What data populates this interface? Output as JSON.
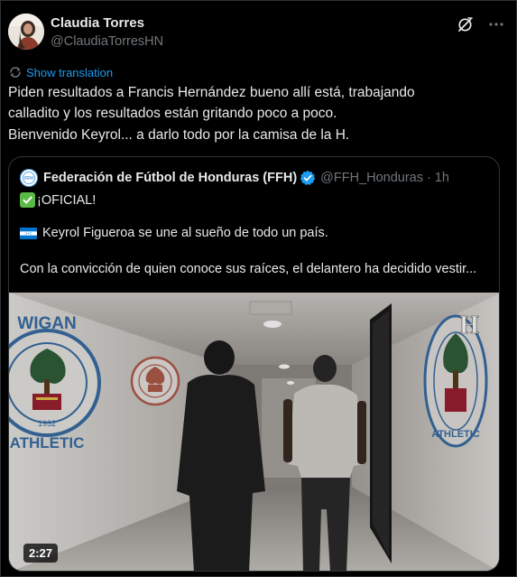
{
  "author": {
    "name": "Claudia Torres",
    "handle": "@ClaudiaTorresHN"
  },
  "actions": {
    "grok_icon": "grok-icon",
    "more_icon": "more-icon"
  },
  "translate": {
    "label": "Show translation",
    "icon": "translate-icon"
  },
  "tweet": {
    "lines": [
      "Piden resultados a Francis Hernández bueno allí está, trabajando",
      "calladito y los resultados están gritando poco a poco.",
      "Bienvenido Keyrol... a darlo todo por la camisa de la H."
    ]
  },
  "quote": {
    "name": "Federación de Fútbol de Honduras (FFH)",
    "handle": "@FFH_Honduras",
    "separator": "·",
    "time": "1h",
    "line1": "¡OFICIAL!",
    "line2": "Keyrol Figueroa se une al sueño de todo un país.",
    "line3": "Con la convicción de quien conoce sus raíces, el delantero ha decidido vestir...",
    "logo_text": "FFH",
    "media": {
      "duration": "2:27",
      "badge_left_top": "WIGAN",
      "badge_left_bottom": "ATHLETIC",
      "badge_year": "1932",
      "badge_right_bottom": "ATHLETIC",
      "watermark": "H"
    }
  },
  "colors": {
    "accent": "#1d9bf0",
    "background": "#000000",
    "border": "#2f3336",
    "text_secondary": "#71767b"
  }
}
